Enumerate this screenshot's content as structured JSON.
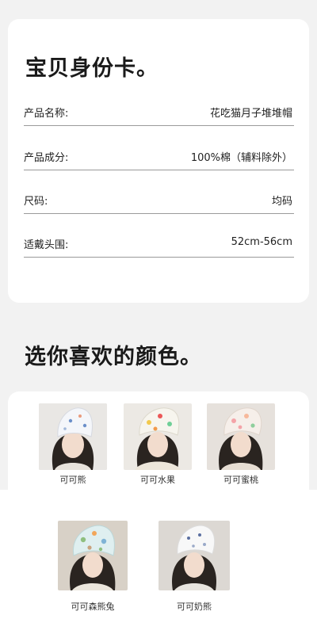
{
  "identity_card": {
    "title": "宝贝身份卡。",
    "rows": [
      {
        "label": "产品名称:",
        "value": "花吃猫月子堆堆帽"
      },
      {
        "label": "产品成分:",
        "value": "100%棉（辅料除外）"
      },
      {
        "label": "尺码:",
        "value": "均码"
      },
      {
        "label": "适戴头围:",
        "value": "52cm-56cm"
      }
    ]
  },
  "colors_section": {
    "title": "选你喜欢的颜色。",
    "options": [
      {
        "name": "可可熊",
        "hat_color": "#f4f6fa",
        "pattern": "bears"
      },
      {
        "name": "可可水果",
        "hat_color": "#f7f5ee",
        "pattern": "fruits"
      },
      {
        "name": "可可蜜桃",
        "hat_color": "#f6efea",
        "pattern": "peaches"
      },
      {
        "name": "可可森熊兔",
        "hat_color": "#dfeff0",
        "pattern": "forest"
      },
      {
        "name": "可可奶熊",
        "hat_color": "#f8f8f8",
        "pattern": "milk-bear"
      }
    ]
  }
}
